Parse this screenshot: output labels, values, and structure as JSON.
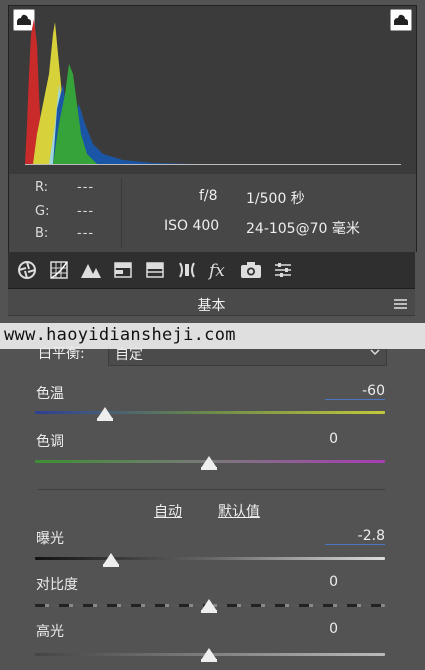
{
  "histogram": {
    "shadow_clip_label": "shadow-clipping-warning",
    "highlight_clip_label": "highlight-clipping-warning"
  },
  "info": {
    "r_label": "R:",
    "g_label": "G:",
    "b_label": "B:",
    "r_value": "---",
    "g_value": "---",
    "b_value": "---",
    "aperture": "f/8",
    "shutter": "1/500 秒",
    "iso": "ISO 400",
    "lens": "24-105@70 毫米"
  },
  "tabs": [
    "basic-icon",
    "tone-curve-icon",
    "detail-icon",
    "hsl-icon",
    "split-toning-icon",
    "lens-corrections-icon",
    "effects-icon",
    "camera-calibration-icon",
    "presets-icon"
  ],
  "panel": {
    "title": "基本",
    "wb_label": "白平衡:",
    "wb_value": "自定",
    "temp_label": "色温",
    "temp_value": "-60",
    "tint_label": "色调",
    "tint_value": "0",
    "auto_label": "自动",
    "default_label": "默认值",
    "exposure_label": "曝光",
    "exposure_value": "-2.8",
    "contrast_label": "对比度",
    "contrast_value": "0",
    "highlights_label": "高光",
    "highlights_value": "0"
  },
  "watermark": "www.haoyidiansheji.com",
  "colors": {
    "accent": "#4a78c0",
    "panel_bg": "#535353",
    "tabbar_bg": "#2f2f2f"
  }
}
